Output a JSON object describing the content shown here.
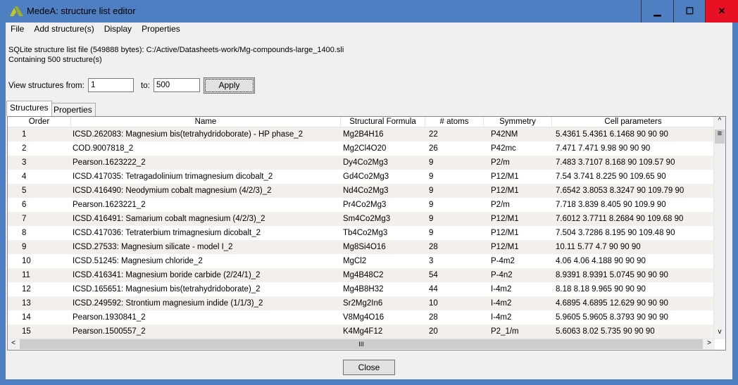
{
  "window": {
    "title": "MedeA: structure list editor",
    "minimize": "▁",
    "maximize": "☐",
    "close": "✕"
  },
  "menu": [
    "File",
    "Add structure(s)",
    "Display",
    "Properties"
  ],
  "info": {
    "file_line": "SQLite structure list file (549888 bytes):  C:/Active/Datasheets-work/Mg-compounds-large_1400.sli",
    "count_line": "Containing 500 structure(s)"
  },
  "view": {
    "from_label": "View structures from:",
    "from_value": "1",
    "to_label": "to:",
    "to_value": "500",
    "apply": "Apply"
  },
  "tabs": [
    "Structures",
    "Properties"
  ],
  "table": {
    "columns": [
      "Order",
      "Name",
      "Structural Formula",
      "# atoms",
      "Symmetry",
      "Cell parameters"
    ],
    "rows": [
      [
        "1",
        "ICSD.262083: Magnesium bis(tetrahydridoborate) - HP phase_2",
        "Mg2B4H16",
        "22",
        "P42NM",
        "5.4361 5.4361 6.1468 90 90 90"
      ],
      [
        "2",
        "COD.9007818_2",
        "Mg2Cl4O20",
        "26",
        "P42mc",
        "7.471 7.471 9.98 90 90 90"
      ],
      [
        "3",
        "Pearson.1623222_2",
        "Dy4Co2Mg3",
        "9",
        "P2/m",
        "7.483 3.7107 8.168 90 109.57 90"
      ],
      [
        "4",
        "ICSD.417035: Tetragadolinium trimagnesium dicobalt_2",
        "Gd4Co2Mg3",
        "9",
        "P12/M1",
        "7.54 3.741 8.225 90 109.65 90"
      ],
      [
        "5",
        "ICSD.416490: Neodymium cobalt magnesium (4/2/3)_2",
        "Nd4Co2Mg3",
        "9",
        "P12/M1",
        "7.6542 3.8053 8.3247 90 109.79 90"
      ],
      [
        "6",
        "Pearson.1623221_2",
        "Pr4Co2Mg3",
        "9",
        "P2/m",
        "7.718 3.839 8.405 90 109.9 90"
      ],
      [
        "7",
        "ICSD.416491: Samarium cobalt magnesium (4/2/3)_2",
        "Sm4Co2Mg3",
        "9",
        "P12/M1",
        "7.6012 3.7711 8.2684 90 109.68 90"
      ],
      [
        "8",
        "ICSD.417036: Tetraterbium trimagnesium dicobalt_2",
        "Tb4Co2Mg3",
        "9",
        "P12/M1",
        "7.504 3.7286 8.195 90 109.48 90"
      ],
      [
        "9",
        "ICSD.27533: Magnesium silicate - model I_2",
        "Mg8Si4O16",
        "28",
        "P12/M1",
        "10.11 5.77 4.7 90 90 90"
      ],
      [
        "10",
        "ICSD.51245: Magnesium chloride_2",
        "MgCl2",
        "3",
        "P-4m2",
        "4.06 4.06 4.188 90 90 90"
      ],
      [
        "11",
        "ICSD.416341: Magnesium boride carbide (2/24/1)_2",
        "Mg4B48C2",
        "54",
        "P-4n2",
        "8.9391 8.9391 5.0745 90 90 90"
      ],
      [
        "12",
        "ICSD.165651: Magnesium bis(tetrahydridoborate)_2",
        "Mg4B8H32",
        "44",
        "I-4m2",
        "8.18 8.18 9.965 90 90 90"
      ],
      [
        "13",
        "ICSD.249592: Strontium magnesium indide (1/1/3)_2",
        "Sr2Mg2In6",
        "10",
        "I-4m2",
        "4.6895 4.6895 12.629 90 90 90"
      ],
      [
        "14",
        "Pearson.1930841_2",
        "V8Mg4O16",
        "28",
        "I-4m2",
        "5.9605 5.9605 8.3793 90 90 90"
      ],
      [
        "15",
        "Pearson.1500557_2",
        "K4Mg4F12",
        "20",
        "P2_1/m",
        "5.6063 8.02 5.735 90 90 90"
      ]
    ]
  },
  "scroll": {
    "up": "^",
    "down": "v",
    "left": "<",
    "right": ">",
    "thumb": "III",
    "vthumb": "≡"
  },
  "close_button": "Close",
  "colors": {
    "titlebar": "#4f7fc3",
    "close_red": "#e81123",
    "row_alt": "#f3efea"
  }
}
